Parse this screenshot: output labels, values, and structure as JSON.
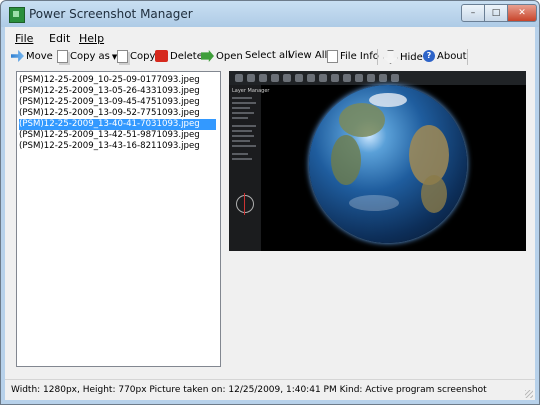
{
  "window": {
    "title": "Power Screenshot Manager",
    "controls": {
      "minimize": "–",
      "maximize": "□",
      "close": "✕"
    }
  },
  "menu": {
    "items": [
      "File",
      "Edit",
      "Help"
    ]
  },
  "toolbar": {
    "move": "Move",
    "copy_as": "Copy as",
    "copy": "Copy",
    "delete": "Delete",
    "open": "Open",
    "select_all": "Select all",
    "view_all": "View All",
    "file_info": "File Info",
    "hide": "Hide",
    "about": "About"
  },
  "files": [
    "(PSM)12-25-2009_10-25-09-0177093.jpeg",
    "(PSM)12-25-2009_13-05-26-4331093.jpeg",
    "(PSM)12-25-2009_13-09-45-4751093.jpeg",
    "(PSM)12-25-2009_13-09-52-7751093.jpeg",
    "(PSM)12-25-2009_13-40-41-7031093.jpeg",
    "(PSM)12-25-2009_13-42-51-9871093.jpeg",
    "(PSM)12-25-2009_13-43-16-8211093.jpeg"
  ],
  "selected_file_index": 4,
  "preview": {
    "panel_title": "Layer Manager"
  },
  "status": {
    "text": "Width: 1280px, Height: 770px Picture taken on: 12/25/2009, 1:40:41 PM Kind: Active program screenshot"
  },
  "colors": {
    "selection": "#3399ff",
    "title_bar": "#b7d1ea",
    "delete_icon": "#d62a1e"
  }
}
